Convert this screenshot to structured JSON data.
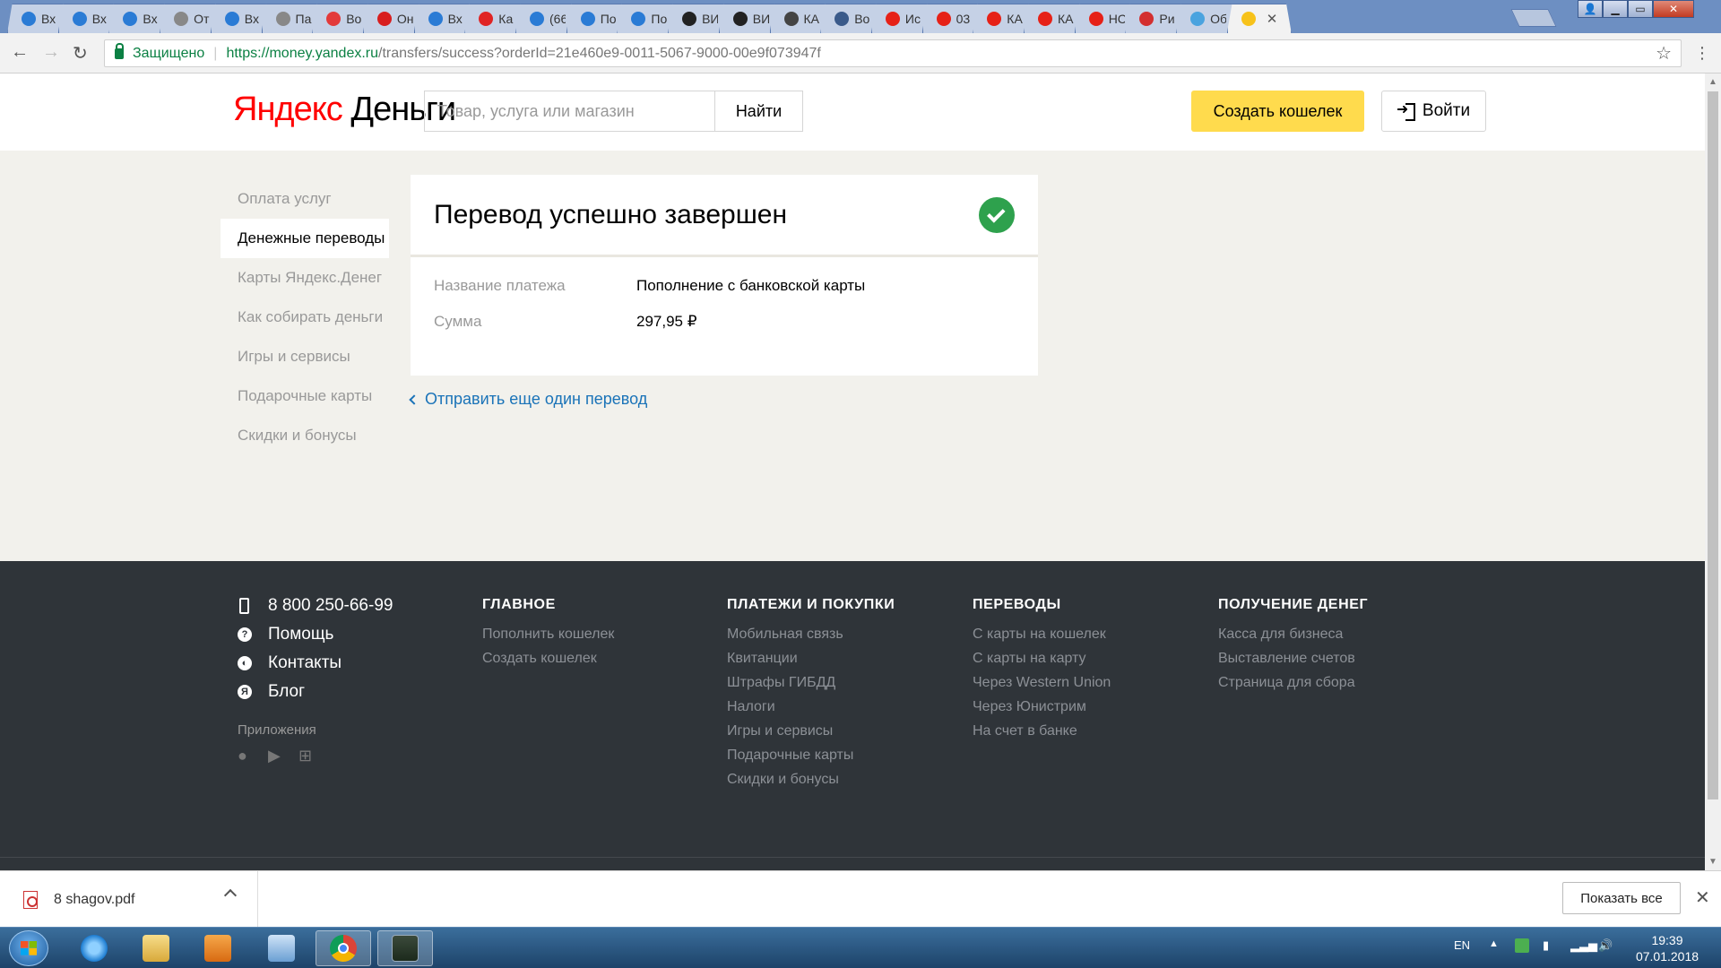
{
  "browser": {
    "tabs": [
      {
        "label": "Вх",
        "icon": "mail-at-icon",
        "color": "#2a7bd5"
      },
      {
        "label": "Вх",
        "icon": "mail-at-icon",
        "color": "#2a7bd5"
      },
      {
        "label": "Вх",
        "icon": "mail-at-icon",
        "color": "#2a7bd5"
      },
      {
        "label": "От",
        "icon": "document-icon",
        "color": "#888888"
      },
      {
        "label": "Вх",
        "icon": "mail-at-icon",
        "color": "#2a7bd5"
      },
      {
        "label": "Па",
        "icon": "document-icon",
        "color": "#888888"
      },
      {
        "label": "Во",
        "icon": "heart-outline-icon",
        "color": "#e33a3a"
      },
      {
        "label": "Он",
        "icon": "heart-icon",
        "color": "#d81e1e"
      },
      {
        "label": "Вх",
        "icon": "mail-at-icon",
        "color": "#2a7bd5"
      },
      {
        "label": "Ка",
        "icon": "app-icon",
        "color": "#e02424"
      },
      {
        "label": "(66",
        "icon": "mail-at-icon",
        "color": "#2a7bd5"
      },
      {
        "label": "По",
        "icon": "mail-at-icon",
        "color": "#2a7bd5"
      },
      {
        "label": "По",
        "icon": "mail-at-icon",
        "color": "#2a7bd5"
      },
      {
        "label": "ВИ",
        "icon": "yin-icon",
        "color": "#222222"
      },
      {
        "label": "ВИ",
        "icon": "yin-icon",
        "color": "#222222"
      },
      {
        "label": "КА",
        "icon": "bird-icon",
        "color": "#444444"
      },
      {
        "label": "Во",
        "icon": "avatar-icon",
        "color": "#3a5a8a"
      },
      {
        "label": "Ис",
        "icon": "youtube-icon",
        "color": "#e62117"
      },
      {
        "label": "03",
        "icon": "youtube-icon",
        "color": "#e62117"
      },
      {
        "label": "КА",
        "icon": "youtube-icon",
        "color": "#e62117"
      },
      {
        "label": "КА",
        "icon": "youtube-icon",
        "color": "#e62117"
      },
      {
        "label": "НС",
        "icon": "youtube-icon",
        "color": "#e62117"
      },
      {
        "label": "Ри",
        "icon": "swirl-icon",
        "color": "#d32f2f"
      },
      {
        "label": "Об",
        "icon": "cloud-icon",
        "color": "#4aa3df"
      }
    ],
    "active_tab": {
      "icon": "yandex-money-icon",
      "color": "#f7c21a",
      "close": "✕"
    },
    "secure_label": "Защищено",
    "url_host": "https://money.yandex.ru",
    "url_path": "/transfers/success?orderId=21e460e9-0011-5067-9000-00e9f073947f"
  },
  "header": {
    "logo_ya": "Яндекс",
    "logo_dengi": "Деньги",
    "search_placeholder": "Товар, услуга или магазин",
    "search_button": "Найти",
    "create_wallet": "Создать кошелек",
    "login": "Войти"
  },
  "sidebar": {
    "items": [
      {
        "label": "Оплата услуг",
        "active": false
      },
      {
        "label": "Денежные переводы",
        "active": true
      },
      {
        "label": "Карты Яндекс.Денег",
        "active": false
      },
      {
        "label": "Как собирать деньги",
        "active": false
      },
      {
        "label": "Игры и сервисы",
        "active": false
      },
      {
        "label": "Подарочные карты",
        "active": false
      },
      {
        "label": "Скидки и бонусы",
        "active": false
      }
    ]
  },
  "result": {
    "title": "Перевод успешно завершен",
    "rows": [
      {
        "label": "Название платежа",
        "value": "Пополнение с банковской карты"
      },
      {
        "label": "Сумма",
        "value": "297,95 ₽"
      }
    ],
    "again_link": "Отправить еще один перевод"
  },
  "footer": {
    "contacts": [
      {
        "icon": "phone-icon",
        "label": "8 800 250-66-99"
      },
      {
        "icon": "help-icon",
        "label": "Помощь"
      },
      {
        "icon": "globe-icon",
        "label": "Контакты"
      },
      {
        "icon": "blog-icon",
        "label": "Блог"
      }
    ],
    "apps_label": "Приложения",
    "columns": [
      {
        "title": "ГЛАВНОЕ",
        "links": [
          "Пополнить кошелек",
          "Создать кошелек"
        ]
      },
      {
        "title": "ПЛАТЕЖИ И ПОКУПКИ",
        "links": [
          "Мобильная связь",
          "Квитанции",
          "Штрафы ГИБДД",
          "Налоги",
          "Игры и сервисы",
          "Подарочные карты",
          "Скидки и бонусы"
        ]
      },
      {
        "title": "ПЕРЕВОДЫ",
        "links": [
          "С карты на кошелек",
          "С карты на карту",
          "Через Western Union",
          "Через Юнистрим",
          "На счет в банке"
        ]
      },
      {
        "title": "ПОЛУЧЕНИЕ ДЕНЕГ",
        "links": [
          "Касса для бизнеса",
          "Выставление счетов",
          "Страница для сбора"
        ]
      }
    ]
  },
  "downloads": {
    "file": "8 shagov.pdf",
    "show_all": "Показать все"
  },
  "taskbar": {
    "lang": "EN",
    "time": "19:39",
    "date": "07.01.2018"
  },
  "colors": {
    "accent_yellow": "#ffdb4d",
    "success_green": "#2ea14d",
    "link_blue": "#1a73b8",
    "footer_bg": "#2f3439",
    "page_bg": "#f2f1ec"
  }
}
